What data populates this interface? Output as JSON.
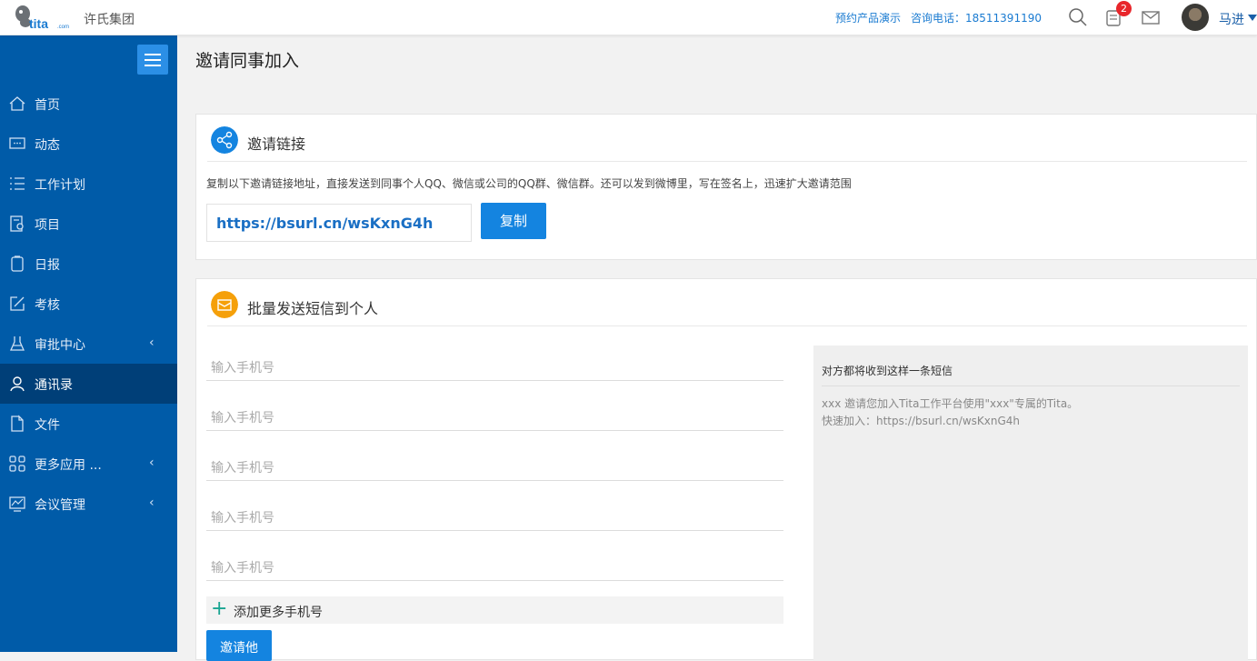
{
  "header": {
    "org_name": "许氏集团",
    "demo_link": "预约产品演示",
    "phone_label": "咨询电话：18511391190",
    "notification_count": "2",
    "user_name": "马进"
  },
  "sidebar": {
    "items": [
      {
        "label": "首页",
        "icon": "home-icon"
      },
      {
        "label": "动态",
        "icon": "chat-icon"
      },
      {
        "label": "工作计划",
        "icon": "list-icon"
      },
      {
        "label": "项目",
        "icon": "project-icon"
      },
      {
        "label": "日报",
        "icon": "daily-report-icon"
      },
      {
        "label": "考核",
        "icon": "assessment-icon"
      },
      {
        "label": "审批中心",
        "icon": "flask-icon"
      },
      {
        "label": "通讯录",
        "icon": "person-icon"
      },
      {
        "label": "文件",
        "icon": "file-icon"
      },
      {
        "label": "更多应用 ...",
        "icon": "grid-icon"
      },
      {
        "label": "会议管理",
        "icon": "meeting-icon"
      }
    ],
    "active": "通讯录"
  },
  "page": {
    "title": "邀请同事加入"
  },
  "invite_link": {
    "title": "邀请链接",
    "description": "复制以下邀请链接地址，直接发送到同事个人QQ、微信或公司的QQ群、微信群。还可以发到微博里，写在签名上，迅速扩大邀请范围",
    "url": "https://bsurl.cn/wsKxnG4h",
    "copy_label": "复制"
  },
  "sms": {
    "title": "批量发送短信到个人",
    "placeholders": [
      "输入手机号",
      "输入手机号",
      "输入手机号",
      "输入手机号",
      "输入手机号"
    ],
    "add_more_label": "添加更多手机号",
    "invite_button": "邀请他",
    "preview_title": "对方都将收到这样一条短信",
    "preview_line1": "xxx 邀请您加入Tita工作平台使用\"xxx\"专属的Tita。",
    "preview_line2": "快速加入：https://bsurl.cn/wsKxnG4h"
  },
  "colors": {
    "sidebar_bg": "#005ba8",
    "sidebar_active": "#003f78",
    "primary_button": "#1484e0",
    "share_icon_bg": "#1484e0",
    "sms_icon_bg": "#f5a00a",
    "badge": "#e8262b"
  }
}
